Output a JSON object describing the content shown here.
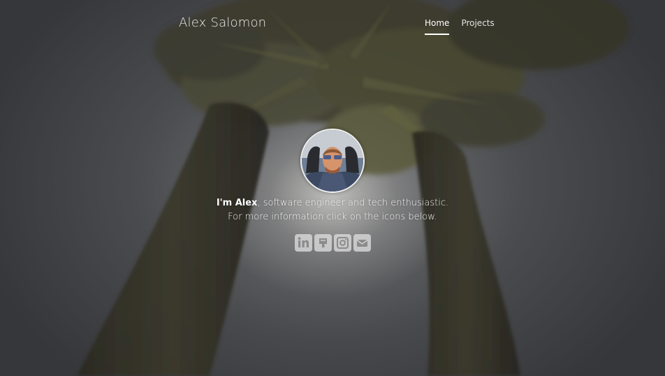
{
  "header": {
    "brand": "Alex Salomon",
    "nav": [
      {
        "label": "Home",
        "active": true
      },
      {
        "label": "Projects",
        "active": false
      }
    ]
  },
  "hero": {
    "avatar_alt": "Alex Salomon avatar",
    "intro_name": "I'm Alex",
    "intro_rest": ", software engineer and tech enthusiastic.",
    "intro_line2": "For more information click on the icons below."
  },
  "social": [
    {
      "icon": "linkedin-icon",
      "label": "LinkedIn"
    },
    {
      "icon": "github-icon",
      "label": "GitHub"
    },
    {
      "icon": "instagram-icon",
      "label": "Instagram"
    },
    {
      "icon": "email-icon",
      "label": "Email"
    }
  ],
  "colors": {
    "text": "#ffffff",
    "icon_bg": "#dcdcdc",
    "icon_fg": "#8a8a8a"
  }
}
